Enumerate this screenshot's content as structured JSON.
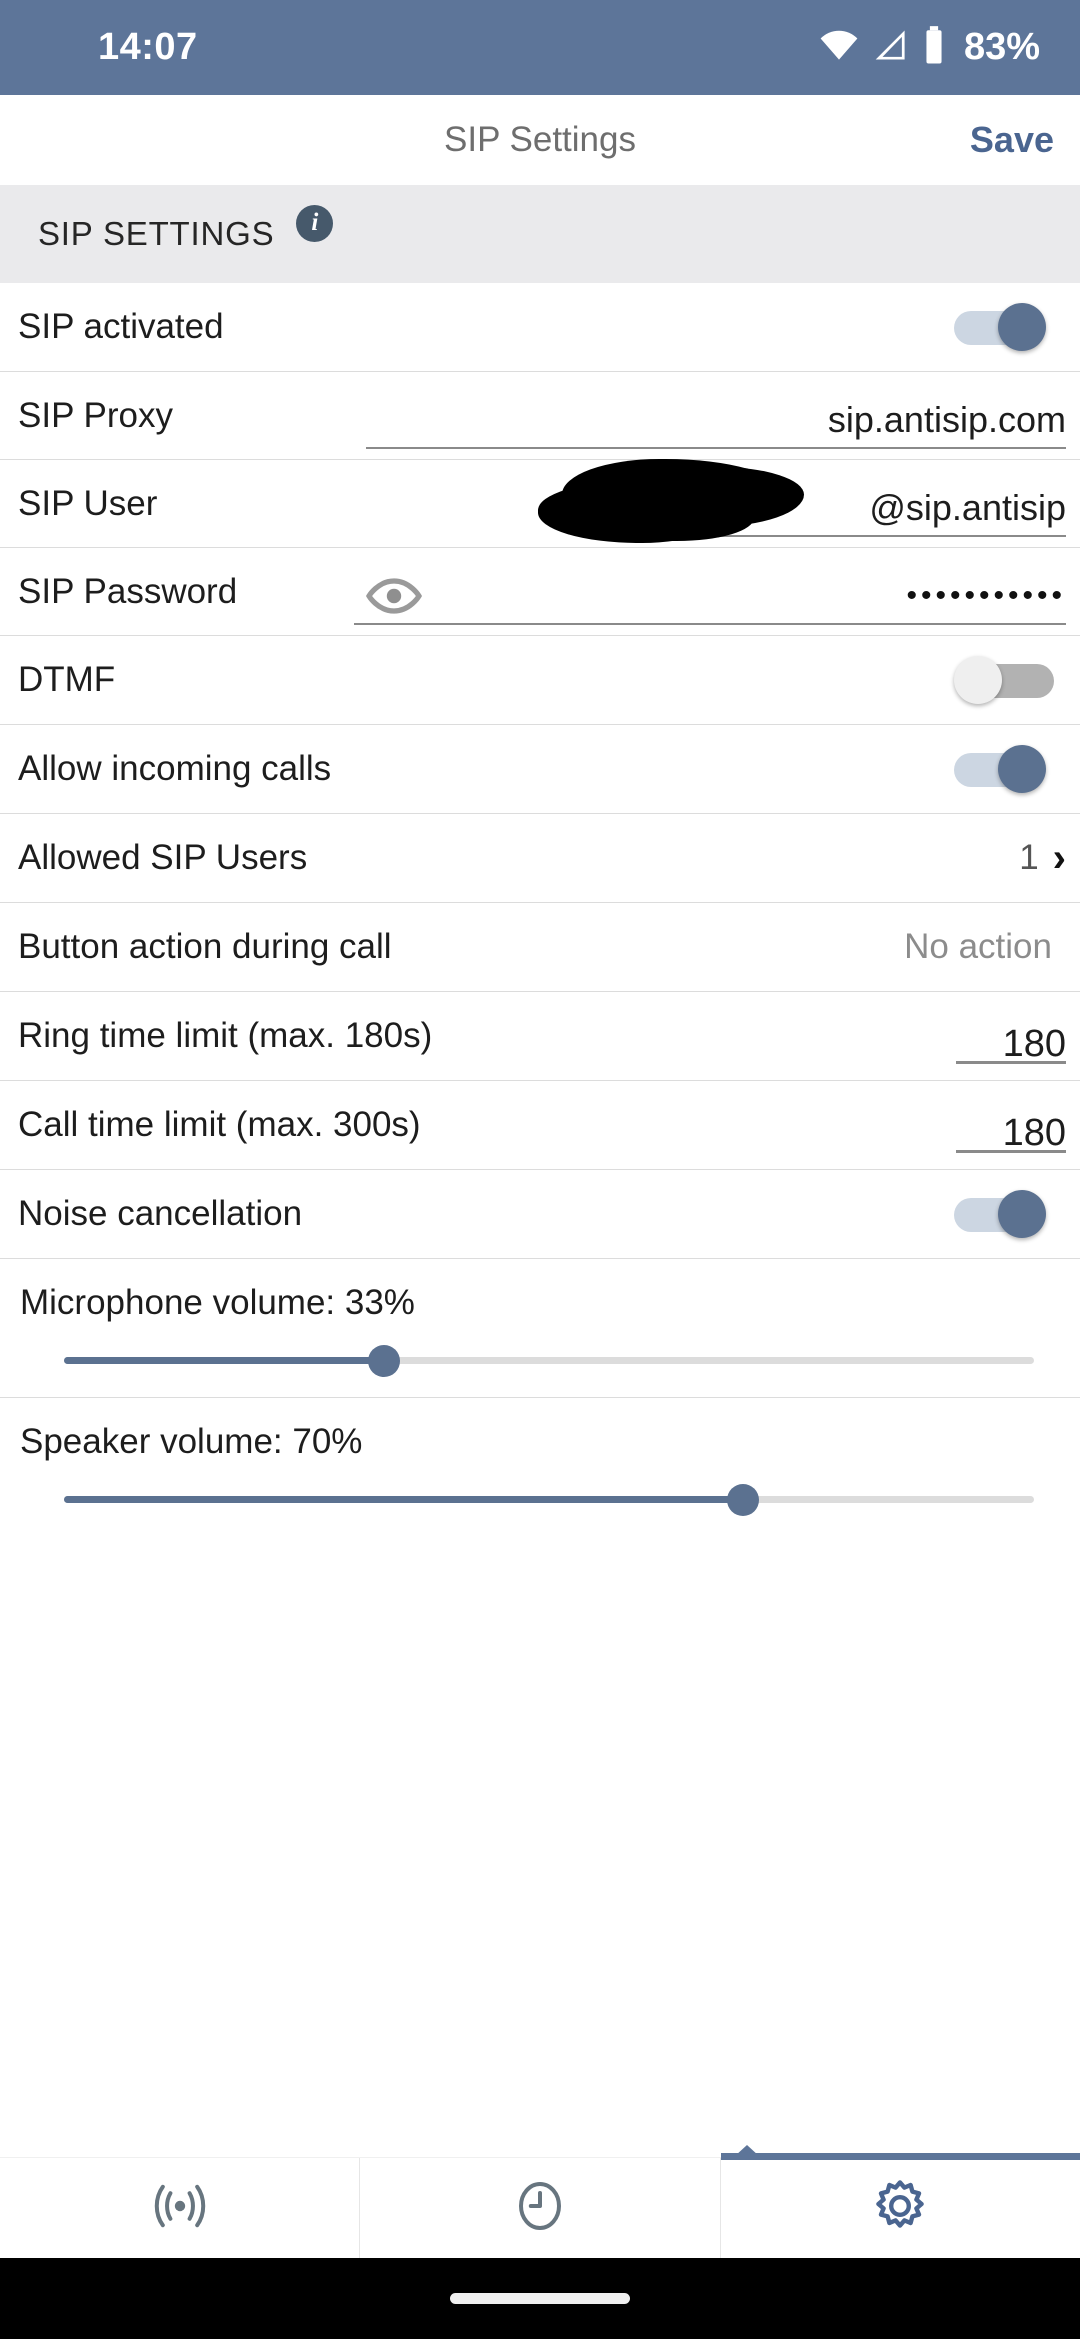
{
  "status_bar": {
    "time": "14:07",
    "battery_percent": "83%",
    "icons": [
      "wifi-icon",
      "cellular-signal-icon",
      "battery-icon"
    ],
    "background_color": "#5d7599"
  },
  "title_bar": {
    "title": "SIP Settings",
    "save_label": "Save",
    "save_color": "#4a6590"
  },
  "section": {
    "header_label": "SIP SETTINGS",
    "info_icon": "info-icon",
    "background_color": "#eaeaec"
  },
  "rows": {
    "sip_activated": {
      "label": "SIP activated",
      "toggle_state": "on"
    },
    "sip_proxy": {
      "label": "SIP Proxy",
      "value": "sip.antisip.com"
    },
    "sip_user": {
      "label": "SIP User",
      "value": "@sip.antisip",
      "redacted": true
    },
    "sip_password": {
      "label": "SIP Password",
      "value": "•••••••••••",
      "eye_icon": "eye-icon"
    },
    "dtmf": {
      "label": "DTMF",
      "toggle_state": "off"
    },
    "allow_incoming_calls": {
      "label": "Allow incoming calls",
      "toggle_state": "on"
    },
    "allowed_sip_users": {
      "label": "Allowed SIP Users",
      "value": "1",
      "chevron": "chevron-right-icon"
    },
    "button_action_during_call": {
      "label": "Button action during call",
      "value": "No action"
    },
    "ring_time_limit": {
      "label": "Ring time limit (max. 180s)",
      "value": "180"
    },
    "call_time_limit": {
      "label": "Call time limit (max. 300s)",
      "value": "180"
    },
    "noise_cancellation": {
      "label": "Noise cancellation",
      "toggle_state": "on"
    },
    "microphone_volume": {
      "label": "Microphone volume: 33%",
      "percent": 33
    },
    "speaker_volume": {
      "label": "Speaker volume: 70%",
      "percent": 70
    }
  },
  "bottom_nav": {
    "tabs": [
      {
        "icon": "broadcast-signal-icon",
        "active": false
      },
      {
        "icon": "clock-icon",
        "active": false
      },
      {
        "icon": "gear-icon",
        "active": true
      }
    ],
    "active_color": "#5d7599",
    "inactive_color": "#67757f"
  },
  "colors": {
    "accent": "#5b7190",
    "divider": "#dcdcdc",
    "toggle_on_track": "#ccd6e2",
    "toggle_off_track": "#b2b2b2"
  }
}
